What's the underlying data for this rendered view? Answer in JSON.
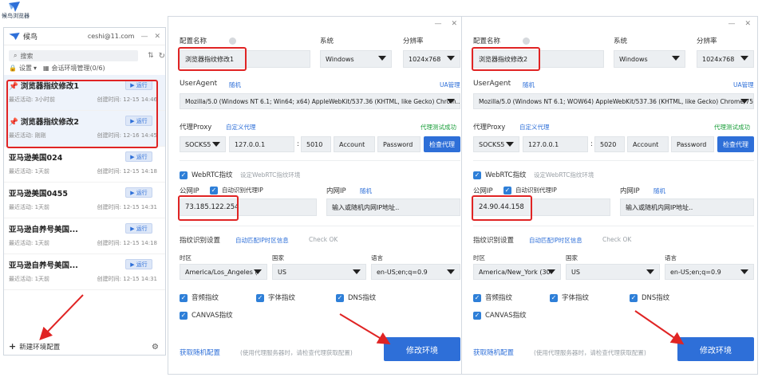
{
  "desktop": {
    "icon_label": "候鸟浏览器"
  },
  "left_panel": {
    "brand": "候鸟",
    "user": "ceshi@11.com",
    "search_placeholder": "搜索",
    "settings_label": "设置",
    "manage_label": "会话环境管理(0/6)",
    "items": [
      {
        "name": "浏览器指纹修改1",
        "activity": "最近活动: 3小时前",
        "created": "创建时间: 12-15 14:46",
        "run": "运行",
        "selected": true,
        "pinned": true
      },
      {
        "name": "浏览器指纹修改2",
        "activity": "最近活动: 刚刚",
        "created": "创建时间: 12-16 14:45",
        "run": "运行",
        "selected": true,
        "pinned": true
      },
      {
        "name": "亚马逊美国024",
        "activity": "最近活动: 1天前",
        "created": "创建时间: 12-15 14:18",
        "run": "运行"
      },
      {
        "name": "亚马逊美国0455",
        "activity": "最近活动: 1天前",
        "created": "创建时间: 12-15 14:31",
        "run": "运行"
      },
      {
        "name": "亚马逊自养号美国...",
        "activity": "最近活动: 1天前",
        "created": "创建时间: 12-15 14:18",
        "run": "运行"
      },
      {
        "name": "亚马逊自养号美国...",
        "activity": "最近活动: 1天前",
        "created": "创建时间: 12-15 14:31",
        "run": "运行"
      }
    ],
    "new_env": "新建环境配置"
  },
  "labels": {
    "config_name": "配置名称",
    "system": "系统",
    "resolution": "分辨率",
    "useragent": "UserAgent",
    "random": "随机",
    "ua_manage": "UA管理",
    "proxy": "代理Proxy",
    "custom_proxy": "自定义代理",
    "proxy_ok": "代理测试成功",
    "account": "Account",
    "password": "Password",
    "check_proxy": "检查代理",
    "webrtc": "WebRTC指纹",
    "webrtc_hint": "设定WebRTC指纹环境",
    "public_ip": "公网IP",
    "auto_proxy_ip": "自动识别代理IP",
    "intranet_ip": "内网IP",
    "intranet_placeholder": "输入或随机内网IP地址..",
    "fp_settings": "指纹识别设置",
    "auto_match": "自动匹配IP时区信息",
    "check_ok": "Check OK",
    "timezone": "时区",
    "country": "国家",
    "language": "语言",
    "audio": "音频指纹",
    "font": "字体指纹",
    "dns": "DNS指纹",
    "canvas": "CANVAS指纹",
    "get_random": "获取随机配置",
    "hint": "(使用代理服务器时，请检查代理获取配置)",
    "modify": "修改环境"
  },
  "configs": [
    {
      "name": "浏览器指纹修改1",
      "system": "Windows",
      "resolution": "1024x768",
      "ua": "Mozilla/5.0 (Windows NT 6.1; Win64; x64) AppleWebKit/537.36 (KHTML, like Gecko) Chrom...",
      "proxy_type": "SOCKS5",
      "host": "127.0.0.1",
      "port": "5010",
      "public_ip": "73.185.122.254",
      "timezone": "America/Los_Angeles (",
      "country": "US",
      "lang": "en-US;en;q=0.9"
    },
    {
      "name": "浏览器指纹修改2",
      "system": "Windows",
      "resolution": "1024x768",
      "ua": "Mozilla/5.0 (Windows NT 6.1; WOW64) AppleWebKit/537.36 (KHTML, like Gecko) Chrome/75...",
      "proxy_type": "SOCKS5",
      "host": "127.0.0.1",
      "port": "5020",
      "public_ip": "24.90.44.158",
      "timezone": "America/New_York (30",
      "country": "US",
      "lang": "en-US;en;q=0.9"
    }
  ]
}
